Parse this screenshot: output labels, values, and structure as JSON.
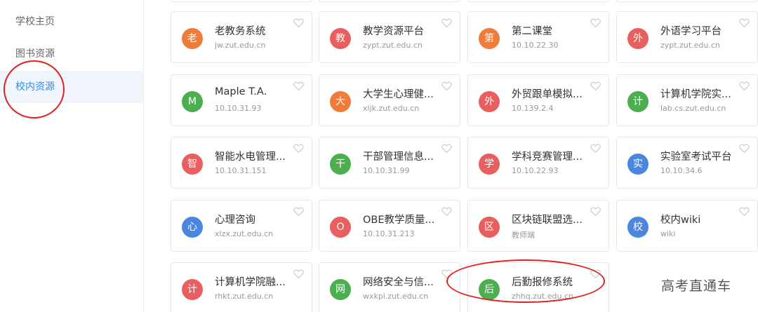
{
  "sidebar": {
    "items": [
      {
        "label": "学校主页",
        "active": false
      },
      {
        "label": "图书资源",
        "active": false
      },
      {
        "label": "校内资源",
        "active": true
      }
    ]
  },
  "colors": {
    "orange": "#f07c3c",
    "red": "#e95f5f",
    "green": "#4cae4f",
    "blue": "#4a86e0",
    "active_text": "#2d8cf0",
    "annotation_red": "#e0201c"
  },
  "cards": [
    {
      "avatar": "老",
      "color": "orange",
      "title": "老教务系统",
      "subtitle": "jw.zut.edu.cn"
    },
    {
      "avatar": "教",
      "color": "red",
      "title": "教学资源平台",
      "subtitle": "zypt.zut.edu.cn"
    },
    {
      "avatar": "第",
      "color": "orange",
      "title": "第二课堂",
      "subtitle": "10.10.22.30"
    },
    {
      "avatar": "外",
      "color": "red",
      "title": "外语学习平台",
      "subtitle": "zypt.zut.edu.cn"
    },
    {
      "avatar": "M",
      "color": "green",
      "title": "Maple T.A.",
      "subtitle": "10.10.31.93"
    },
    {
      "avatar": "大",
      "color": "orange",
      "title": "大学生心理健...",
      "subtitle": "xljk.zut.edu.cn"
    },
    {
      "avatar": "外",
      "color": "red",
      "title": "外贸跟单模拟...",
      "subtitle": "10.139.2.4"
    },
    {
      "avatar": "计",
      "color": "green",
      "title": "计算机学院实...",
      "subtitle": "lab.cs.zut.edu.cn"
    },
    {
      "avatar": "智",
      "color": "red",
      "title": "智能水电管理...",
      "subtitle": "10.10.31.151"
    },
    {
      "avatar": "干",
      "color": "green",
      "title": "干部管理信息...",
      "subtitle": "10.10.31.99"
    },
    {
      "avatar": "学",
      "color": "red",
      "title": "学科竞赛管理...",
      "subtitle": "10.10.22.93"
    },
    {
      "avatar": "实",
      "color": "blue",
      "title": "实验室考试平台",
      "subtitle": "10.10.34.6"
    },
    {
      "avatar": "心",
      "color": "blue",
      "title": "心理咨询",
      "subtitle": "xlzx.zut.edu.cn"
    },
    {
      "avatar": "O",
      "color": "red",
      "title": "OBE教学质量...",
      "subtitle": "10.10.31.213"
    },
    {
      "avatar": "区",
      "color": "red",
      "title": "区块链联盟选...",
      "subtitle": "教师端"
    },
    {
      "avatar": "校",
      "color": "blue",
      "title": "校内wiki",
      "subtitle": "wiki"
    },
    {
      "avatar": "计",
      "color": "red",
      "title": "计算机学院融...",
      "subtitle": "rhkt.zut.edu.cn"
    },
    {
      "avatar": "网",
      "color": "green",
      "title": "网络安全与信...",
      "subtitle": "wxkpi.zut.edu.cn"
    },
    {
      "avatar": "后",
      "color": "green",
      "title": "后勤报修系统",
      "subtitle": "zhhq.zut.edu.cn"
    }
  ],
  "watermark": "高考直通车"
}
